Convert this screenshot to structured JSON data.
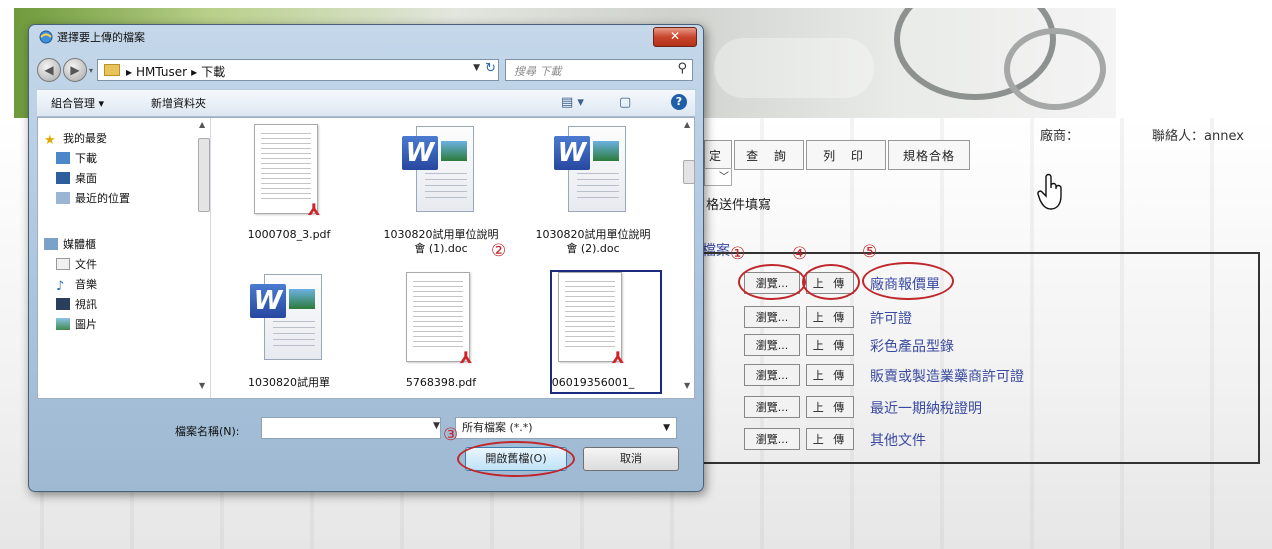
{
  "page": {
    "vendor_label": "廠商：",
    "contact_label": "聯絡人：annex",
    "toolbar": [
      "定",
      "查 詢",
      "列 印",
      "規格合格"
    ],
    "fill_label": "格送件填寫",
    "section_label": "檔案",
    "documents": [
      {
        "browse": "瀏覽...",
        "upload": "上 傳",
        "name": "廠商報價單"
      },
      {
        "browse": "瀏覽...",
        "upload": "上 傳",
        "name": "許可證"
      },
      {
        "browse": "瀏覽...",
        "upload": "上 傳",
        "name": "彩色產品型錄"
      },
      {
        "browse": "瀏覽...",
        "upload": "上 傳",
        "name": "販賣或製造業藥商許可證"
      },
      {
        "browse": "瀏覽...",
        "upload": "上 傳",
        "name": "最近一期納稅證明"
      },
      {
        "browse": "瀏覽...",
        "upload": "上 傳",
        "name": "其他文件"
      }
    ],
    "step_marks": [
      "①",
      "②",
      "③",
      "④",
      "⑤"
    ]
  },
  "dialog": {
    "title": "選擇要上傳的檔案",
    "close": "✕",
    "breadcrumbs": [
      "▸",
      "HMTuser",
      "▸",
      "下載"
    ],
    "search_placeholder": "搜尋 下載",
    "organize": "組合管理 ▾",
    "new_folder": "新增資料夾",
    "nav_items": [
      "我的最愛",
      "下載",
      "桌面",
      "最近的位置",
      "媒體櫃",
      "文件",
      "音樂",
      "視訊",
      "圖片"
    ],
    "files": [
      {
        "name": "1000708_3.pdf",
        "type": "pdf"
      },
      {
        "name": "1030820試用單位說明會 (1).doc",
        "type": "word"
      },
      {
        "name": "1030820試用單位說明會 (2).doc",
        "type": "word"
      },
      {
        "name": "1030820試用單",
        "type": "word"
      },
      {
        "name": "5768398.pdf",
        "type": "pdf"
      },
      {
        "name": "06019356001_",
        "type": "pdf"
      }
    ],
    "filename_label": "檔案名稱(N):",
    "filename_value": "",
    "filetype": "所有檔案 (*.*)",
    "open": "開啟舊檔(O)",
    "cancel": "取消"
  },
  "colors": {
    "accent_red": "#c0272d",
    "link_blue": "#3a4aa0"
  }
}
